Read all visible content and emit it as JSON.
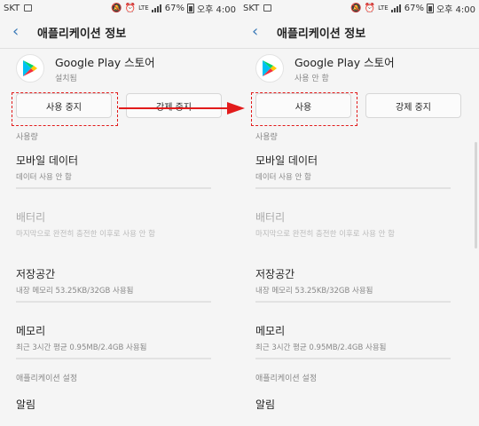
{
  "status": {
    "carrier": "SKT",
    "lte": "LTE",
    "battery": "67%",
    "time": "오후 4:00"
  },
  "appbar": {
    "title": "애플리케이션 정보"
  },
  "app": {
    "name": "Google Play 스토어"
  },
  "left": {
    "app_state": "설치됨",
    "btn1_label": "사용 중지",
    "btn2_label": "강제 중지"
  },
  "right": {
    "app_state": "사용 안 함",
    "btn1_label": "사용",
    "btn2_label": "강제 중지"
  },
  "sections": {
    "usage": "사용량",
    "app_settings": "애플리케이션 설정"
  },
  "items": [
    {
      "title": "모바일 데이터",
      "subtitle": "데이터 사용 안 함"
    },
    {
      "title": "배터리",
      "subtitle": "마지막으로 완전히 충전한 이후로 사용 안 함"
    },
    {
      "title": "저장공간",
      "subtitle": "내장 메모리 53.25KB/32GB 사용됨"
    },
    {
      "title": "메모리",
      "subtitle": "최근 3시간 평균 0.95MB/2.4GB 사용됨"
    }
  ],
  "partial_item": "알림",
  "colors": {
    "accent": "#3b7ab8",
    "highlight": "#e21b1b"
  }
}
